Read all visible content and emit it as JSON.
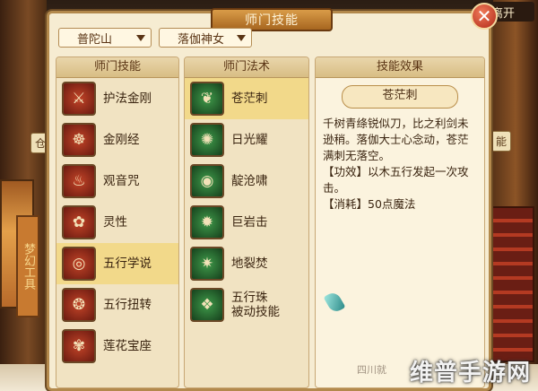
{
  "exit_label": "离开",
  "panel": {
    "title": "师门技能",
    "close_symbol": "✕"
  },
  "filters": {
    "school": "普陀山",
    "master": "落伽神女"
  },
  "columns": {
    "skills_header": "师门技能",
    "spells_header": "师门法术",
    "effect_header": "技能效果"
  },
  "skills": [
    {
      "label": "护法金刚",
      "icon": "vajra-icon",
      "glyph": "⚔"
    },
    {
      "label": "金刚经",
      "icon": "sutra-icon",
      "glyph": "☸"
    },
    {
      "label": "观音咒",
      "icon": "pagoda-icon",
      "glyph": "♨"
    },
    {
      "label": "灵性",
      "icon": "spirit-icon",
      "glyph": "✿"
    },
    {
      "label": "五行学说",
      "icon": "five-elements-icon",
      "glyph": "◎"
    },
    {
      "label": "五行扭转",
      "icon": "twist-icon",
      "glyph": "❂"
    },
    {
      "label": "莲花宝座",
      "icon": "lotus-icon",
      "glyph": "✾"
    }
  ],
  "selected_skill_index": 4,
  "spells": [
    {
      "label": "苍茫刺",
      "label2": "",
      "icon": "thorn-icon",
      "glyph": "❦"
    },
    {
      "label": "日光耀",
      "label2": "",
      "icon": "sun-icon",
      "glyph": "✺"
    },
    {
      "label": "靛沧啸",
      "label2": "",
      "icon": "wave-icon",
      "glyph": "◉"
    },
    {
      "label": "巨岩击",
      "label2": "",
      "icon": "rock-icon",
      "glyph": "✹"
    },
    {
      "label": "地裂焚",
      "label2": "",
      "icon": "fissure-icon",
      "glyph": "✷"
    },
    {
      "label": "五行珠",
      "label2": "被动技能",
      "icon": "orbs-icon",
      "glyph": "❖"
    }
  ],
  "selected_spell_index": 0,
  "effect": {
    "name": "苍茫刺",
    "description": "千树青绦锐似刀，比之利剑未逊稍。落伽大士心念动，苍茫满刺无落空。",
    "effect_line": "【功效】以木五行发起一次攻击。",
    "cost_line": "【消耗】50点魔法"
  },
  "background": {
    "vertical_sign": "梦幻工具",
    "side_tab_left": "仓",
    "side_tab_right": "能"
  },
  "watermark_small": "四川就",
  "watermark": "维普手游网",
  "colors": {
    "panel_bg": "#f6ecd2",
    "selected_row": "#f2d98a",
    "title_plate": "#b5732c",
    "skill_icon": "#c24428",
    "spell_icon": "#3f9a4a"
  }
}
